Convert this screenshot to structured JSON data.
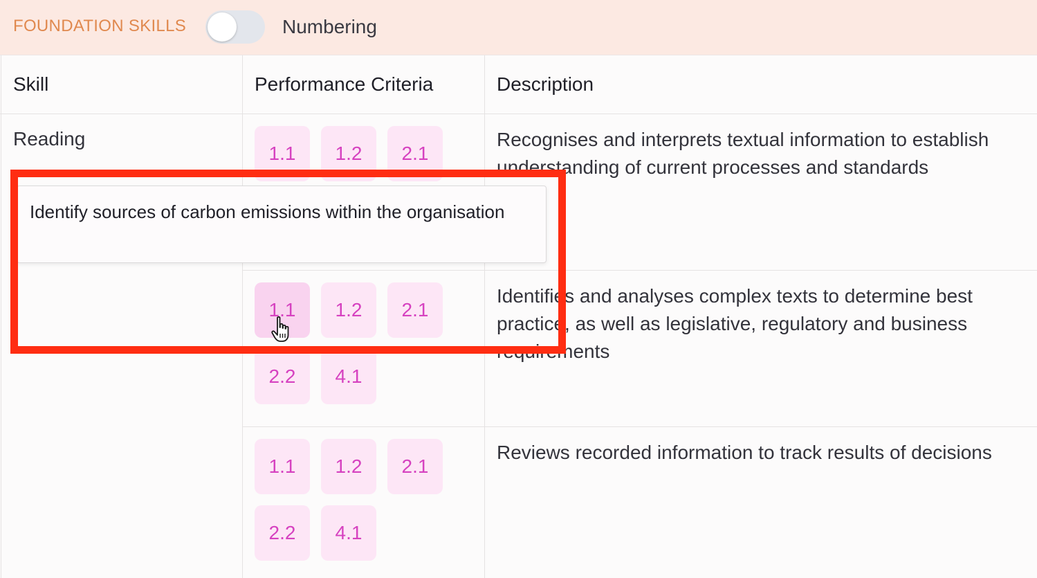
{
  "header": {
    "section_title": "FOUNDATION SKILLS",
    "toggle_label": "Numbering",
    "toggle_on": false
  },
  "table": {
    "columns": [
      "Skill",
      "Performance Criteria",
      "Description"
    ],
    "rows": [
      {
        "skill": "Reading",
        "criteria": [
          "1.1",
          "1.2",
          "2.1"
        ],
        "description": "Recognises and interprets textual information to establish understanding of current processes and standards"
      },
      {
        "skill": "",
        "criteria": [
          "1.1",
          "1.2",
          "2.1",
          "2.2",
          "4.1"
        ],
        "description": "Identifies and analyses complex texts to determine best practice, as well as legislative, regulatory and business requirements"
      },
      {
        "skill": "",
        "criteria": [
          "1.1",
          "1.2",
          "2.1",
          "2.2",
          "4.1"
        ],
        "description": "Reviews recorded information to track results of decisions"
      }
    ]
  },
  "tooltip": {
    "text": "Identify sources of carbon emissions within the organisation"
  },
  "colors": {
    "header_bg": "#fce9e2",
    "section_title": "#e0894f",
    "chip_bg": "#fde6f6",
    "chip_text": "#d642c0",
    "highlight": "#ff2d12"
  }
}
